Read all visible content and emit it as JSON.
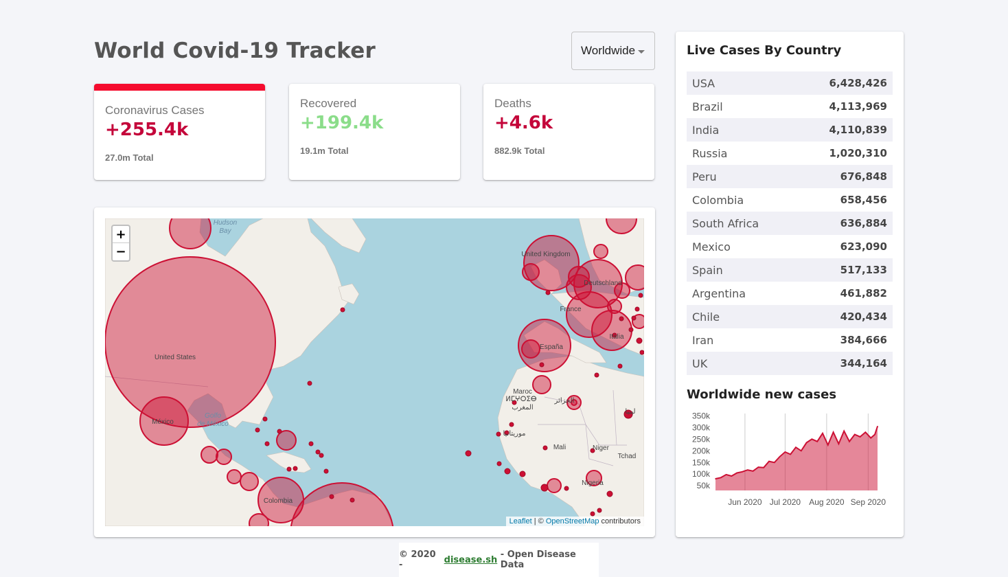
{
  "header": {
    "title": "World Covid-19 Tracker"
  },
  "country_select": {
    "value": "Worldwide"
  },
  "info_cards": [
    {
      "label": "Coronavirus Cases",
      "value": "+255.4k",
      "total": "27.0m Total"
    },
    {
      "label": "Recovered",
      "value": "+199.4k",
      "total": "19.1m Total"
    },
    {
      "label": "Deaths",
      "value": "+4.6k",
      "total": "882.9k Total"
    }
  ],
  "map": {
    "zoom_in": "+",
    "zoom_out": "−",
    "attribution": {
      "leaflet": "Leaflet",
      "sep": " | © ",
      "osm": "OpenStreetMap",
      "suffix": " contributors"
    },
    "labels": [
      "Hudson",
      "Bay",
      "United States",
      "México",
      "Golfo",
      "de México",
      "Colombia",
      "United Kingdom",
      "Deutschland",
      "France",
      "España",
      "Italia",
      "Maroc",
      "ⵍⵎⵖⵔⵉⴱ",
      "المغرب",
      "الجزائر",
      "موريتانيا",
      "ليبيا",
      "Mali",
      "Niger",
      "Tchad",
      "Nigeria"
    ]
  },
  "sidebar": {
    "table_title": "Live Cases By Country",
    "countries": [
      {
        "country": "USA",
        "cases": "6,428,426"
      },
      {
        "country": "Brazil",
        "cases": "4,113,969"
      },
      {
        "country": "India",
        "cases": "4,110,839"
      },
      {
        "country": "Russia",
        "cases": "1,020,310"
      },
      {
        "country": "Peru",
        "cases": "676,848"
      },
      {
        "country": "Colombia",
        "cases": "658,456"
      },
      {
        "country": "South Africa",
        "cases": "636,884"
      },
      {
        "country": "Mexico",
        "cases": "623,090"
      },
      {
        "country": "Spain",
        "cases": "517,133"
      },
      {
        "country": "Argentina",
        "cases": "461,882"
      },
      {
        "country": "Chile",
        "cases": "420,434"
      },
      {
        "country": "Iran",
        "cases": "384,666"
      },
      {
        "country": "UK",
        "cases": "344,164"
      }
    ],
    "chart_title": "Worldwide new cases"
  },
  "chart_data": {
    "type": "area",
    "title": "Worldwide new cases",
    "xlabel": "",
    "ylabel": "",
    "yticks": [
      "50k",
      "100k",
      "150k",
      "200k",
      "250k",
      "300k",
      "350k"
    ],
    "xticks": [
      "Jun 2020",
      "Jul 2020",
      "Aug 2020",
      "Sep 2020"
    ],
    "ylim": [
      30000,
      360000
    ],
    "x": [
      "2020-05-10",
      "2020-05-14",
      "2020-05-18",
      "2020-05-22",
      "2020-05-26",
      "2020-05-30",
      "2020-06-03",
      "2020-06-07",
      "2020-06-11",
      "2020-06-15",
      "2020-06-19",
      "2020-06-23",
      "2020-06-27",
      "2020-07-01",
      "2020-07-05",
      "2020-07-09",
      "2020-07-13",
      "2020-07-17",
      "2020-07-21",
      "2020-07-25",
      "2020-07-29",
      "2020-08-02",
      "2020-08-06",
      "2020-08-10",
      "2020-08-14",
      "2020-08-18",
      "2020-08-22",
      "2020-08-26",
      "2020-08-30",
      "2020-09-03",
      "2020-09-06",
      "2020-09-08"
    ],
    "series": [
      {
        "values": [
          80000,
          85000,
          98000,
          92000,
          105000,
          110000,
          118000,
          113000,
          130000,
          128000,
          155000,
          150000,
          175000,
          195000,
          185000,
          215000,
          200000,
          235000,
          250000,
          240000,
          275000,
          225000,
          280000,
          230000,
          285000,
          240000,
          270000,
          260000,
          280000,
          255000,
          270000,
          305000
        ]
      }
    ],
    "color": "#cc1034",
    "fill": "rgba(204,16,52,0.5)",
    "grid": "vertical lines at month ticks"
  },
  "footer": {
    "prefix": "© 2020 - ",
    "link": "disease.sh",
    "suffix": " - Open Disease Data"
  }
}
